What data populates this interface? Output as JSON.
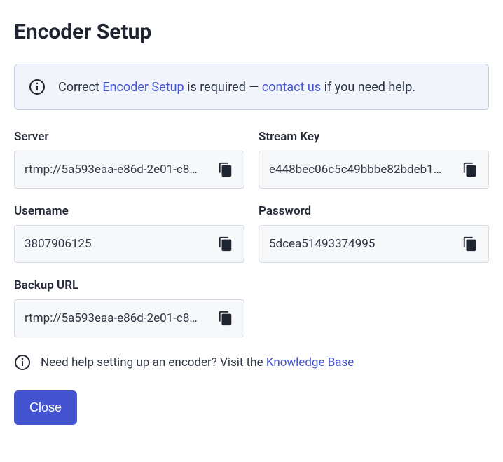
{
  "title": "Encoder Setup",
  "banner": {
    "prefix": "Correct ",
    "link1": "Encoder Setup",
    "mid": " is required — ",
    "link2": "contact us",
    "suffix": " if you need help."
  },
  "fields": {
    "server": {
      "label": "Server",
      "value": "rtmp://5a593eaa-e86d-2e01-c8…"
    },
    "streamKey": {
      "label": "Stream Key",
      "value": "e448bec06c5c49bbbe82bdeb1…"
    },
    "username": {
      "label": "Username",
      "value": "3807906125"
    },
    "password": {
      "label": "Password",
      "value": "5dcea51493374995"
    },
    "backup": {
      "label": "Backup URL",
      "value": "rtmp://5a593eaa-e86d-2e01-c8…"
    }
  },
  "help": {
    "text": "Need help setting up an encoder? Visit the ",
    "link": "Knowledge Base"
  },
  "closeLabel": "Close"
}
